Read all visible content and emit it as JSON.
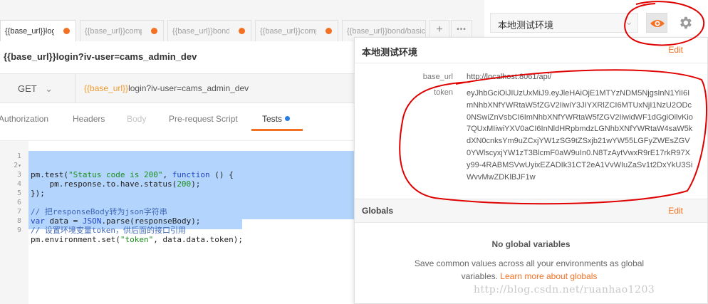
{
  "tabs": [
    {
      "label": "{{base_url}}login?iv-user=cams_admin_dev",
      "active": true
    },
    {
      "label": "{{base_url}}company/list"
    },
    {
      "label": "{{base_url}}bond/list"
    },
    {
      "label": "{{base_url}}company/detail"
    },
    {
      "label": "{{base_url}}bond/basic"
    }
  ],
  "tab_actions": {
    "add": "+",
    "more": "•••"
  },
  "environment": {
    "selected": "本地测试环境",
    "chevron_icon": "chevron-down-icon",
    "quick_look_icon": "eye-icon",
    "settings_icon": "gear-icon"
  },
  "request": {
    "title": "{{base_url}}login?iv-user=cams_admin_dev",
    "method": "GET",
    "url_var": "{{base_url}}",
    "url_rest": "login?iv-user=cams_admin_dev"
  },
  "subtabs": {
    "authorization": "Authorization",
    "headers": "Headers",
    "body": "Body",
    "prerequest": "Pre-request Script",
    "tests": "Tests"
  },
  "editor": {
    "lines": [
      {
        "n": "1"
      },
      {
        "n": "2",
        "p1": "pm.test(",
        "s1": "\"Status code is 200\"",
        "p2": ", ",
        "k1": "function",
        "p3": " () {"
      },
      {
        "n": "3",
        "p1": "    pm.response.to.have.status(",
        "num": "200",
        "p2": ");"
      },
      {
        "n": "4",
        "p1": "});"
      },
      {
        "n": "5"
      },
      {
        "n": "6",
        "c": "// 把responseBody转为json字符串"
      },
      {
        "n": "7",
        "k1": "var",
        "p1": " data = ",
        "k2": "JSON",
        "p2": ".parse(responseBody);"
      },
      {
        "n": "8",
        "c": "// 设置环境变量token，供后面的接口引用"
      },
      {
        "n": "9",
        "p1": "pm.environment.set(",
        "s1": "\"token\"",
        "p2": ", data.data.token);"
      }
    ]
  },
  "env_panel": {
    "title": "本地测试环境",
    "edit": "Edit",
    "vars": [
      {
        "key": "base_url",
        "value": "http://localhost:8061/api/"
      },
      {
        "key": "token",
        "value": "eyJhbGciOiJIUzUxMiJ9.eyJleHAiOjE1MTYzNDM5NjgsInN1YiI6ImNhbXNfYWRtaW5fZGV2IiwiY3JIYXRlZCI6MTUxNjI1NzU2ODc0NSwiZnVsbCI6ImNhbXNfYWRtaW5fZGV2IiwidWF1dGgiOilvKio7QUxMIiwiYXV0aCI6InNldHRpbmdzLGNhbXNfYWRtaW4saW5kdXN0cnksYm9uZCxjYW1zSG9tZSxjb21wYW55LGFyZWEsZGV0YWlscyxjYW1zT3BlcmF0aW9uIn0.N8TzAytVwxR9rE17rkR97Xy99-4RABMSVwUyixEZADIk31CT2eA1VvWIuZaSv1t2DxYkU3SiWvvMwZDKlBJF1w"
      }
    ],
    "globals_title": "Globals",
    "globals_edit": "Edit",
    "no_globals": "No global variables",
    "globals_desc": "Save common values across all your environments as global variables.",
    "globals_link": "Learn more about globals"
  },
  "watermark": "http://blog.csdn.net/ruanhao1203",
  "colors": {
    "accent": "#f47023",
    "annotation": "#e00000",
    "selection": "#b3d4fc"
  }
}
